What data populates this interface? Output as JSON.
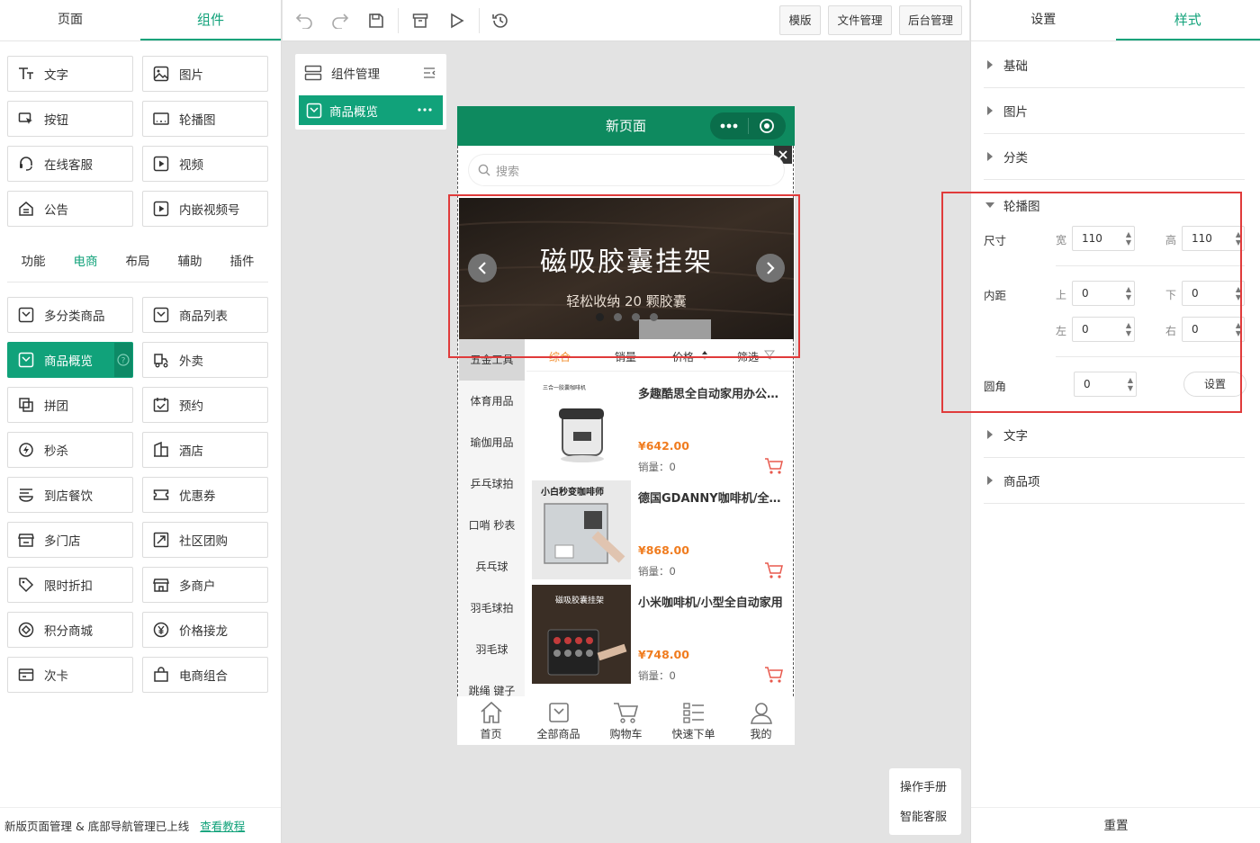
{
  "left_panel": {
    "tabs": [
      "页面",
      "组件"
    ],
    "basic_items": [
      "文字",
      "图片",
      "按钮",
      "轮播图",
      "在线客服",
      "视频",
      "公告",
      "内嵌视频号"
    ],
    "category_tabs": [
      "功能",
      "电商",
      "布局",
      "辅助",
      "插件"
    ],
    "ecommerce_items": [
      "多分类商品",
      "商品列表",
      "商品概览",
      "外卖",
      "拼团",
      "预约",
      "秒杀",
      "酒店",
      "到店餐饮",
      "优惠券",
      "多门店",
      "社区团购",
      "限时折扣",
      "多商户",
      "积分商城",
      "价格接龙",
      "次卡",
      "电商组合"
    ],
    "notice_text": "新版页面管理 & 底部导航管理已上线",
    "notice_link": "查看教程"
  },
  "toolbar": {
    "buttons": [
      "模版",
      "文件管理",
      "后台管理"
    ]
  },
  "tree": {
    "header": "组件管理",
    "selected": "商品概览"
  },
  "phone": {
    "title": "新页面",
    "search_placeholder": "搜索",
    "banner": {
      "title": "磁吸胶囊挂架",
      "subtitle": "轻松收纳 20 颗胶囊"
    },
    "categories": [
      "五金工具",
      "体育用品",
      "瑜伽用品",
      "乒乓球拍",
      "口哨 秒表",
      "兵乓球",
      "羽毛球拍",
      "羽毛球",
      "跳绳 键子"
    ],
    "sorts": [
      "综合",
      "销量",
      "价格",
      "筛选"
    ],
    "products": [
      {
        "name": "多趣酷思全自动家用办公意式咖啡机",
        "price": "¥642.00",
        "sales": "销量：0",
        "img_caption": "三合一胶囊咖啡机"
      },
      {
        "name": "德国GDANNY咖啡机/全自动",
        "price": "¥868.00",
        "sales": "销量：0",
        "img_caption": "小白秒变咖啡师"
      },
      {
        "name": "小米咖啡机/小型全自动家用",
        "price": "¥748.00",
        "sales": "销量：0",
        "img_caption": "磁吸胶囊挂架"
      }
    ],
    "tabbar": [
      "首页",
      "全部商品",
      "购物车",
      "快速下单",
      "我的"
    ]
  },
  "help": {
    "manual": "操作手册",
    "service": "智能客服"
  },
  "right_panel": {
    "tabs": [
      "设置",
      "样式"
    ],
    "sections_top": [
      "基础",
      "图片",
      "分类"
    ],
    "carousel": {
      "title": "轮播图",
      "size_label": "尺寸",
      "width_label": "宽",
      "width": "110",
      "height_label": "高",
      "height": "110",
      "padding_label": "内距",
      "top_label": "上",
      "top": "0",
      "bottom_label": "下",
      "bottom": "0",
      "left_label": "左",
      "left": "0",
      "right_label": "右",
      "right": "0",
      "radius_label": "圆角",
      "radius": "0",
      "set_button": "设置"
    },
    "sections_bottom": [
      "文字",
      "商品项"
    ],
    "reset": "重置"
  },
  "colors": {
    "accent": "#11a27a",
    "header_green": "#0e8a5f",
    "price": "#f07c1f",
    "highlight_box": "#e03b3b"
  }
}
